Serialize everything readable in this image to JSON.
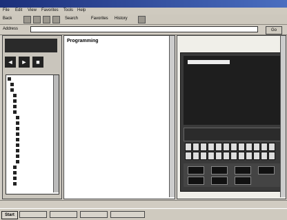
{
  "window": {
    "title": ""
  },
  "menu": [
    "File",
    "Edit",
    "View",
    "Favorites",
    "Tools",
    "Help"
  ],
  "toolbar": {
    "back": "Back",
    "search": "Search",
    "favorites": "Favorites",
    "history": "History"
  },
  "address": {
    "label": "Address",
    "value": "",
    "go": "Go"
  },
  "left_panel": {
    "header": "",
    "nav": [
      "◄",
      "►",
      "■"
    ],
    "tree": [
      "",
      "",
      "",
      "",
      "",
      "",
      "",
      "",
      "",
      "",
      "",
      "",
      "",
      "",
      "",
      "",
      "",
      "",
      "",
      ""
    ]
  },
  "content": {
    "title": "Programming",
    "paragraphs": [
      "",
      "",
      "",
      "",
      ""
    ]
  },
  "right_panel": {
    "caption": "",
    "sim_bar": ""
  },
  "status": {
    "text": ""
  },
  "taskbar": {
    "start": "Start",
    "tasks": [
      "",
      "",
      "",
      ""
    ],
    "clock": ""
  },
  "colors": {
    "title_bar": "#1c2f7a",
    "dark": "#222222"
  }
}
